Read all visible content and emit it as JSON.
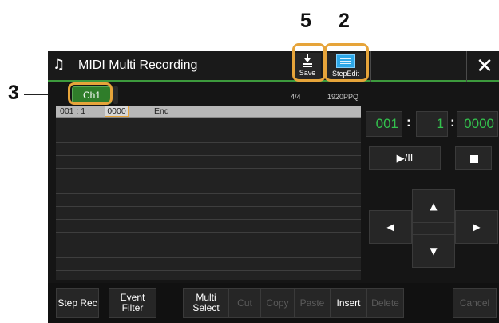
{
  "callouts": {
    "step_edit": "2",
    "channel_tab": "3",
    "save": "5"
  },
  "titlebar": {
    "icon": "♫",
    "title": "MIDI Multi Recording",
    "close": "✕"
  },
  "toolbar": {
    "save_label": "Save",
    "step_edit_label": "StepEdit"
  },
  "channel": {
    "tab_label": "Ch1"
  },
  "info": {
    "time_signature": "4/4",
    "resolution": "1920PPQ"
  },
  "event_list": {
    "rows": [
      {
        "position_prefix": "001 : 1 :",
        "position_tick": "0000",
        "event": "End"
      }
    ]
  },
  "position": {
    "measure": "001",
    "beat": "1",
    "clock": "0000",
    "separator": ":"
  },
  "transport": {
    "play_pause": "▶/II"
  },
  "navigation": {
    "up": "▲",
    "down": "▼",
    "left": "◀",
    "right": "▶"
  },
  "bottom_buttons": {
    "step_rec": "Step Rec",
    "event_filter": "Event Filter",
    "multi_select": "Multi Select",
    "cut": "Cut",
    "copy": "Copy",
    "paste": "Paste",
    "insert": "Insert",
    "delete": "Delete",
    "cancel": "Cancel"
  },
  "colors": {
    "accent_green": "#33c24d",
    "highlight_orange": "#e6a43a",
    "step_icon_blue": "#2ea8e8"
  }
}
